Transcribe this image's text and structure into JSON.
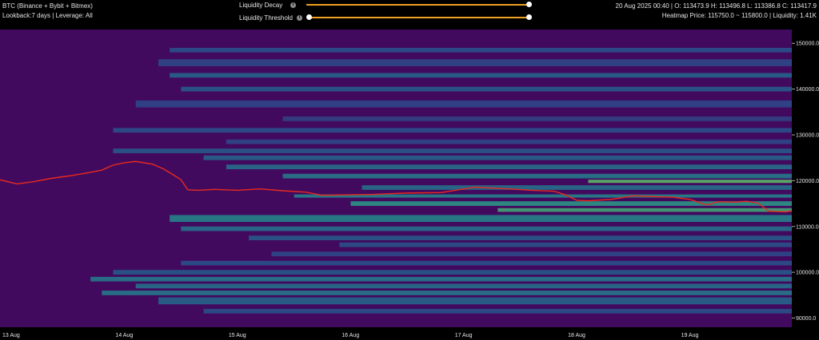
{
  "header": {
    "title": "BTC (Binance + Bybit + Bitmex)",
    "subtitle": "Lookback:7 days | Leverage: All",
    "ohlc": "20 Aug 2025 00:40 | O: 113473.9 H: 113496.8 L: 113386.8 C: 113417.9",
    "heatmap_info": "Heatmap Price: 115750.0 ~ 115800.0 | Liquidity: 1.41K"
  },
  "controls": {
    "decay": {
      "label": "Liquidity Decay",
      "value": 1.0
    },
    "threshold": {
      "label": "Liquidity Threshold",
      "min": 0.0,
      "max": 1.0
    }
  },
  "colors": {
    "background": "#420a5f",
    "price_line": "#e82a1c",
    "slider": "#f0a020"
  },
  "chart_data": {
    "type": "heatmap",
    "xticks": [
      "13 Aug",
      "14 Aug",
      "15 Aug",
      "16 Aug",
      "17 Aug",
      "18 Aug",
      "19 Aug"
    ],
    "yticks": [
      "150000.0",
      "140000.0",
      "130000.0",
      "120000.0",
      "110000.0",
      "100000.0",
      "90000.0"
    ],
    "ytick_values": [
      150000,
      140000,
      130000,
      120000,
      110000,
      100000,
      90000
    ],
    "xlim": [
      0,
      7
    ],
    "ylim": [
      88000,
      153000
    ],
    "price": {
      "x": [
        0,
        0.15,
        0.3,
        0.45,
        0.6,
        0.75,
        0.9,
        1.0,
        1.1,
        1.2,
        1.35,
        1.45,
        1.55,
        1.6,
        1.66,
        1.75,
        1.9,
        2.1,
        2.3,
        2.5,
        2.7,
        2.85,
        3.0,
        3.3,
        3.6,
        3.9,
        4.2,
        4.5,
        4.7,
        4.9,
        5.0,
        5.1,
        5.2,
        5.4,
        5.6,
        5.8,
        5.95,
        6.1,
        6.25,
        6.35,
        6.5,
        6.6,
        6.7,
        6.8,
        6.95,
        7.0
      ],
      "y": [
        120200,
        119300,
        119800,
        120500,
        121000,
        121600,
        122300,
        123400,
        123900,
        124200,
        123600,
        122500,
        121000,
        120200,
        118000,
        117900,
        118100,
        117900,
        118200,
        117800,
        117500,
        116800,
        116900,
        117000,
        117300,
        117400,
        118600,
        118200,
        117900,
        117700,
        116900,
        115700,
        115600,
        115900,
        116700,
        116500,
        116400,
        115900,
        114700,
        115400,
        115300,
        115500,
        115100,
        113300,
        113200,
        113400
      ]
    },
    "heat_bands": [
      {
        "y": [
          148000,
          149000
        ],
        "x0": 1.5,
        "i": 0.35
      },
      {
        "y": [
          145000,
          146500
        ],
        "x0": 1.4,
        "i": 0.3
      },
      {
        "y": [
          142500,
          143500
        ],
        "x0": 1.5,
        "i": 0.45
      },
      {
        "y": [
          139500,
          140500
        ],
        "x0": 1.6,
        "i": 0.4
      },
      {
        "y": [
          136000,
          137500
        ],
        "x0": 1.2,
        "i": 0.3
      },
      {
        "y": [
          133000,
          134000
        ],
        "x0": 2.5,
        "i": 0.25
      },
      {
        "y": [
          130500,
          131500
        ],
        "x0": 1.0,
        "i": 0.35
      },
      {
        "y": [
          128000,
          129000
        ],
        "x0": 2.0,
        "i": 0.3
      },
      {
        "y": [
          126000,
          127000
        ],
        "x0": 1.0,
        "i": 0.4
      },
      {
        "y": [
          124500,
          125500
        ],
        "x0": 1.8,
        "i": 0.45
      },
      {
        "y": [
          122500,
          123500
        ],
        "x0": 2.0,
        "i": 0.5
      },
      {
        "y": [
          120500,
          121500
        ],
        "x0": 2.5,
        "i": 0.55
      },
      {
        "y": [
          119500,
          120200
        ],
        "x0": 5.2,
        "i": 0.9
      },
      {
        "y": [
          118000,
          119000
        ],
        "x0": 3.2,
        "i": 0.5
      },
      {
        "y": [
          116300,
          117000
        ],
        "x0": 2.6,
        "i": 0.6
      },
      {
        "y": [
          114500,
          115500
        ],
        "x0": 3.1,
        "i": 0.7
      },
      {
        "y": [
          113200,
          114000
        ],
        "x0": 4.4,
        "i": 0.8
      },
      {
        "y": [
          111000,
          112500
        ],
        "x0": 1.5,
        "i": 0.6
      },
      {
        "y": [
          109000,
          110000
        ],
        "x0": 1.6,
        "i": 0.5
      },
      {
        "y": [
          107000,
          108000
        ],
        "x0": 2.2,
        "i": 0.4
      },
      {
        "y": [
          105500,
          106500
        ],
        "x0": 3.0,
        "i": 0.35
      },
      {
        "y": [
          103500,
          104500
        ],
        "x0": 2.4,
        "i": 0.3
      },
      {
        "y": [
          101500,
          102500
        ],
        "x0": 1.6,
        "i": 0.35
      },
      {
        "y": [
          99500,
          100500
        ],
        "x0": 1.0,
        "i": 0.4
      },
      {
        "y": [
          98000,
          99000
        ],
        "x0": 0.8,
        "i": 0.55
      },
      {
        "y": [
          96500,
          97500
        ],
        "x0": 1.2,
        "i": 0.5
      },
      {
        "y": [
          95000,
          96000
        ],
        "x0": 0.9,
        "i": 0.55
      },
      {
        "y": [
          93000,
          94500
        ],
        "x0": 1.4,
        "i": 0.45
      },
      {
        "y": [
          91000,
          92000
        ],
        "x0": 1.8,
        "i": 0.35
      }
    ]
  }
}
